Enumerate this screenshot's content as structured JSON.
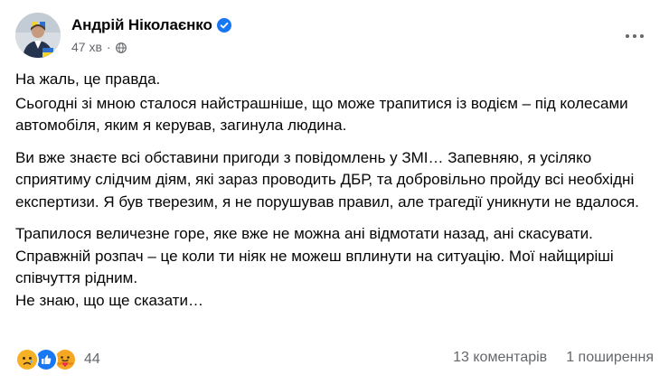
{
  "post": {
    "author": "Андрій Ніколаєнко",
    "time": "47 хв",
    "paragraphs": [
      "На жаль, це правда.",
      "Сьогодні зі мною сталося найстрашніше, що може трапитися із водієм – під колесами автомобіля, яким я керував, загинула людина.",
      "Ви вже знаєте всі обставини пригоди з повідомлень у ЗМІ… Запевняю, я усіляко сприятиму слідчим діям, які зараз проводить ДБР, та добровільно пройду всі необхідні експертизи. Я був тверезим, я не порушував правил, але трагедії уникнути не вдалося.",
      "Трапилося величезне горе, яке вже не можна ані відмотати назад, ані скасувати. Справжній розпач – це коли ти ніяк не можеш вплинути на ситуацію. Мої найщиріші співчуття рідним.",
      "Не знаю, що ще сказати…"
    ]
  },
  "icons": {
    "avatar": "avatar",
    "verified": "verified-badge-icon",
    "audience": "globe-icon",
    "more": "more-options-icon",
    "reactions": [
      "sad-reaction-icon",
      "like-reaction-icon",
      "care-reaction-icon"
    ]
  },
  "colors": {
    "verified": "#1877f2",
    "secondary_text": "#65676b",
    "like": "#1877f2",
    "sad": "#f7b125",
    "care": "#f5a623"
  },
  "footer": {
    "reaction_count": "44",
    "comments": "13 коментарів",
    "shares": "1 поширення"
  }
}
